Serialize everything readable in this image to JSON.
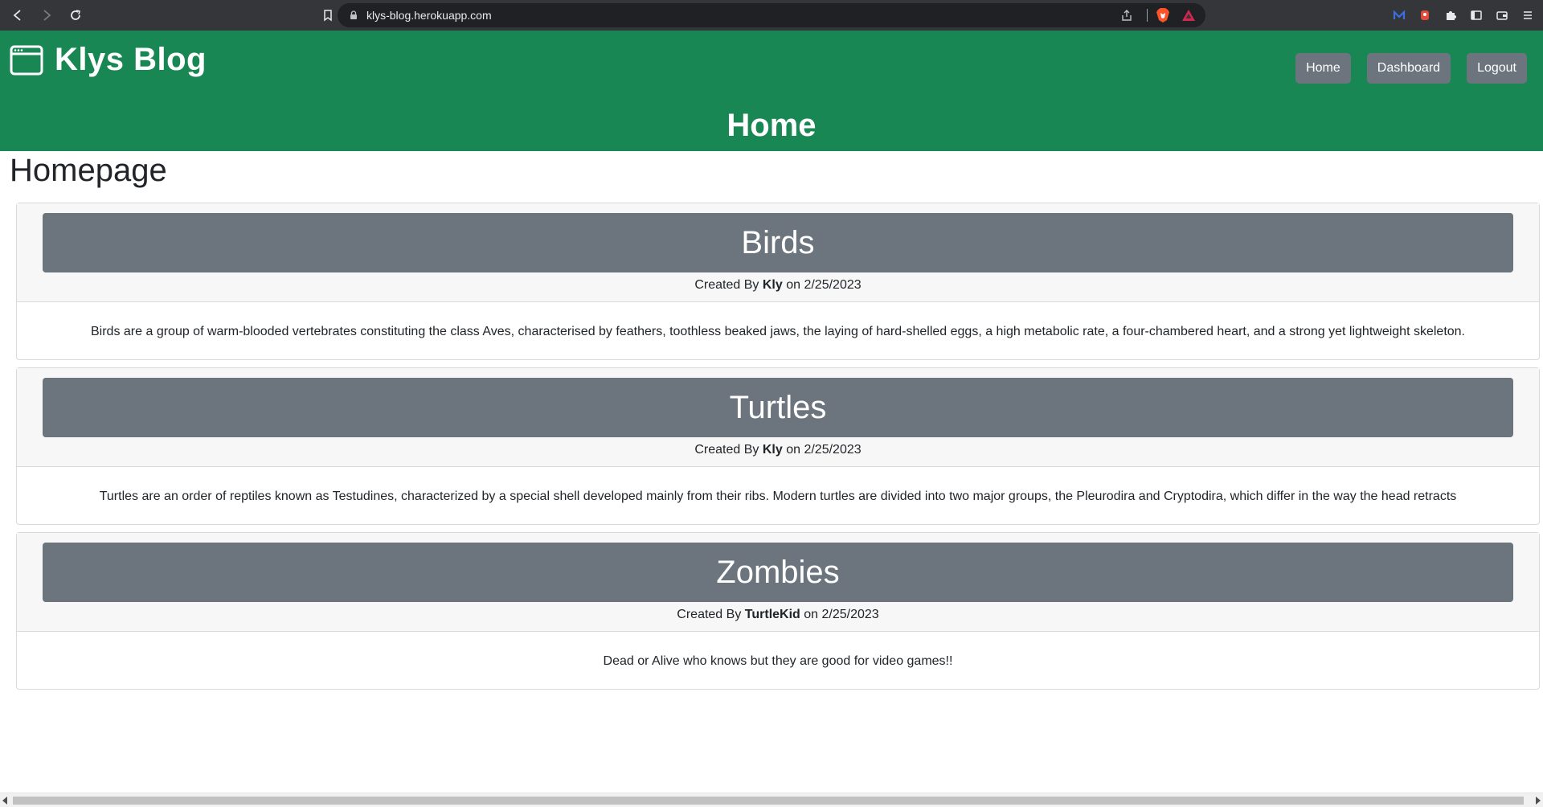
{
  "browser": {
    "url": "klys-blog.herokuapp.com"
  },
  "header": {
    "brand": "Klys Blog",
    "nav": {
      "home": "Home",
      "dashboard": "Dashboard",
      "logout": "Logout"
    },
    "page_heading": "Home"
  },
  "main": {
    "title": "Homepage",
    "posts": [
      {
        "title": "Birds",
        "created_by_prefix": "Created By",
        "author": "Kly",
        "date_prefix": "on",
        "date": "2/25/2023",
        "body": "Birds are a group of warm-blooded vertebrates constituting the class Aves, characterised by feathers, toothless beaked jaws, the laying of hard-shelled eggs, a high metabolic rate, a four-chambered heart, and a strong yet lightweight skeleton."
      },
      {
        "title": "Turtles",
        "created_by_prefix": "Created By",
        "author": "Kly",
        "date_prefix": "on",
        "date": "2/25/2023",
        "body": "Turtles are an order of reptiles known as Testudines, characterized by a special shell developed mainly from their ribs. Modern turtles are divided into two major groups, the Pleurodira and Cryptodira, which differ in the way the head retracts"
      },
      {
        "title": "Zombies",
        "created_by_prefix": "Created By",
        "author": "TurtleKid",
        "date_prefix": "on",
        "date": "2/25/2023",
        "body": "Dead or Alive who knows but they are good for video games!!"
      }
    ]
  },
  "colors": {
    "header_green": "#198754",
    "button_gray": "#6c757d",
    "chrome_dark": "#35363a"
  }
}
